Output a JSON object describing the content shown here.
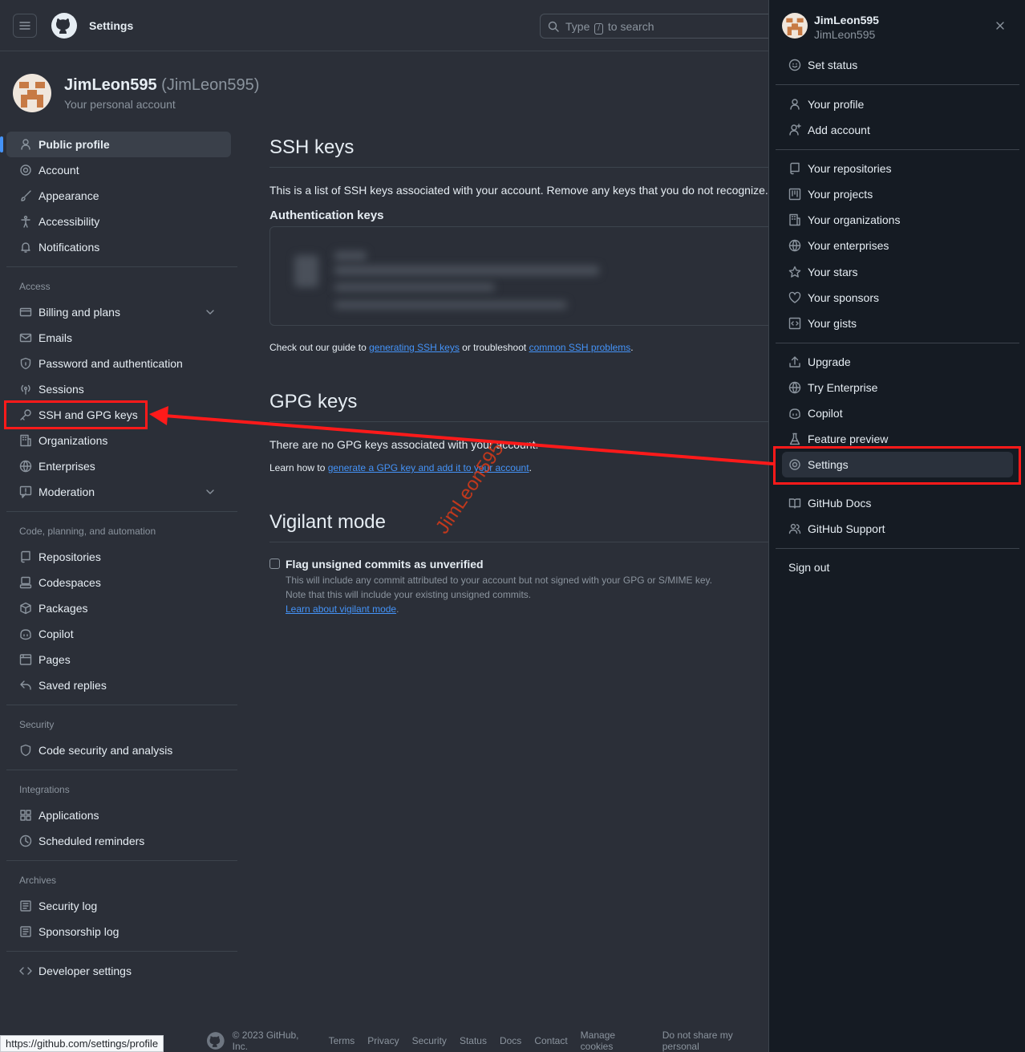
{
  "header": {
    "title": "Settings",
    "search_prefix": "Type",
    "search_key": "/",
    "search_suffix": "to search"
  },
  "account": {
    "name": "JimLeon595",
    "login": "(JimLeon595)",
    "subtitle": "Your personal account"
  },
  "sidebar": {
    "items_top": [
      {
        "label": "Public profile",
        "icon": "person-icon"
      },
      {
        "label": "Account",
        "icon": "gear-icon"
      },
      {
        "label": "Appearance",
        "icon": "paintbrush-icon"
      },
      {
        "label": "Accessibility",
        "icon": "accessibility-icon"
      },
      {
        "label": "Notifications",
        "icon": "bell-icon"
      }
    ],
    "group_access": "Access",
    "items_access": [
      {
        "label": "Billing and plans",
        "icon": "credit-card-icon"
      },
      {
        "label": "Emails",
        "icon": "mail-icon"
      },
      {
        "label": "Password and authentication",
        "icon": "shield-lock-icon"
      },
      {
        "label": "Sessions",
        "icon": "broadcast-icon"
      },
      {
        "label": "SSH and GPG keys",
        "icon": "key-icon"
      },
      {
        "label": "Organizations",
        "icon": "organization-icon"
      },
      {
        "label": "Enterprises",
        "icon": "globe-icon"
      },
      {
        "label": "Moderation",
        "icon": "report-icon"
      }
    ],
    "group_code": "Code, planning, and automation",
    "items_code": [
      {
        "label": "Repositories",
        "icon": "repo-icon"
      },
      {
        "label": "Codespaces",
        "icon": "codespaces-icon"
      },
      {
        "label": "Packages",
        "icon": "package-icon"
      },
      {
        "label": "Copilot",
        "icon": "copilot-icon"
      },
      {
        "label": "Pages",
        "icon": "browser-icon"
      },
      {
        "label": "Saved replies",
        "icon": "reply-icon"
      }
    ],
    "group_security": "Security",
    "items_security": [
      {
        "label": "Code security and analysis",
        "icon": "shield-icon"
      }
    ],
    "group_integrations": "Integrations",
    "items_integrations": [
      {
        "label": "Applications",
        "icon": "apps-icon"
      },
      {
        "label": "Scheduled reminders",
        "icon": "clock-icon"
      }
    ],
    "group_archives": "Archives",
    "items_archives": [
      {
        "label": "Security log",
        "icon": "log-icon"
      },
      {
        "label": "Sponsorship log",
        "icon": "log-icon"
      }
    ],
    "developer_settings": "Developer settings"
  },
  "main": {
    "ssh_title": "SSH keys",
    "ssh_desc": "This is a list of SSH keys associated with your account. Remove any keys that you do not recognize.",
    "auth_keys_title": "Authentication keys",
    "guide_prefix": "Check out our guide to",
    "guide_link1": "generating SSH keys",
    "guide_mid": "or troubleshoot",
    "guide_link2": "common SSH problems",
    "guide_end": ".",
    "gpg_title": "GPG keys",
    "gpg_desc": "There are no GPG keys associated with your account.",
    "gpg_learn_prefix": "Learn how to",
    "gpg_learn_link": "generate a GPG key and add it to your account",
    "gpg_learn_end": ".",
    "vigilant_title": "Vigilant mode",
    "vigilant_checkbox": "Flag unsigned commits as unverified",
    "vigilant_line1": "This will include any commit attributed to your account but not signed with your GPG or S/MIME key.",
    "vigilant_line2": "Note that this will include your existing unsigned commits.",
    "vigilant_link": "Learn about vigilant mode",
    "vigilant_end": "."
  },
  "dropdown": {
    "name": "JimLeon595",
    "login": "JimLeon595",
    "set_status": "Set status",
    "group1": [
      "Your profile",
      "Add account"
    ],
    "group2": [
      "Your repositories",
      "Your projects",
      "Your organizations",
      "Your enterprises",
      "Your stars",
      "Your sponsors",
      "Your gists"
    ],
    "group3": [
      "Upgrade",
      "Try Enterprise",
      "Copilot",
      "Feature preview",
      "Settings"
    ],
    "group4": [
      "GitHub Docs",
      "GitHub Support"
    ],
    "sign_out": "Sign out"
  },
  "footer": {
    "copyright": "© 2023 GitHub, Inc.",
    "links": [
      "Terms",
      "Privacy",
      "Security",
      "Status",
      "Docs",
      "Contact",
      "Manage cookies",
      "Do not share my personal"
    ]
  },
  "status_url": "https://github.com/settings/profile",
  "watermark": "JimLeon595",
  "colors": {
    "accent_blue": "#4493f8",
    "annotation_red": "#ff1a1a",
    "bg": "#2b2f38",
    "overlay_bg": "#151b23"
  }
}
